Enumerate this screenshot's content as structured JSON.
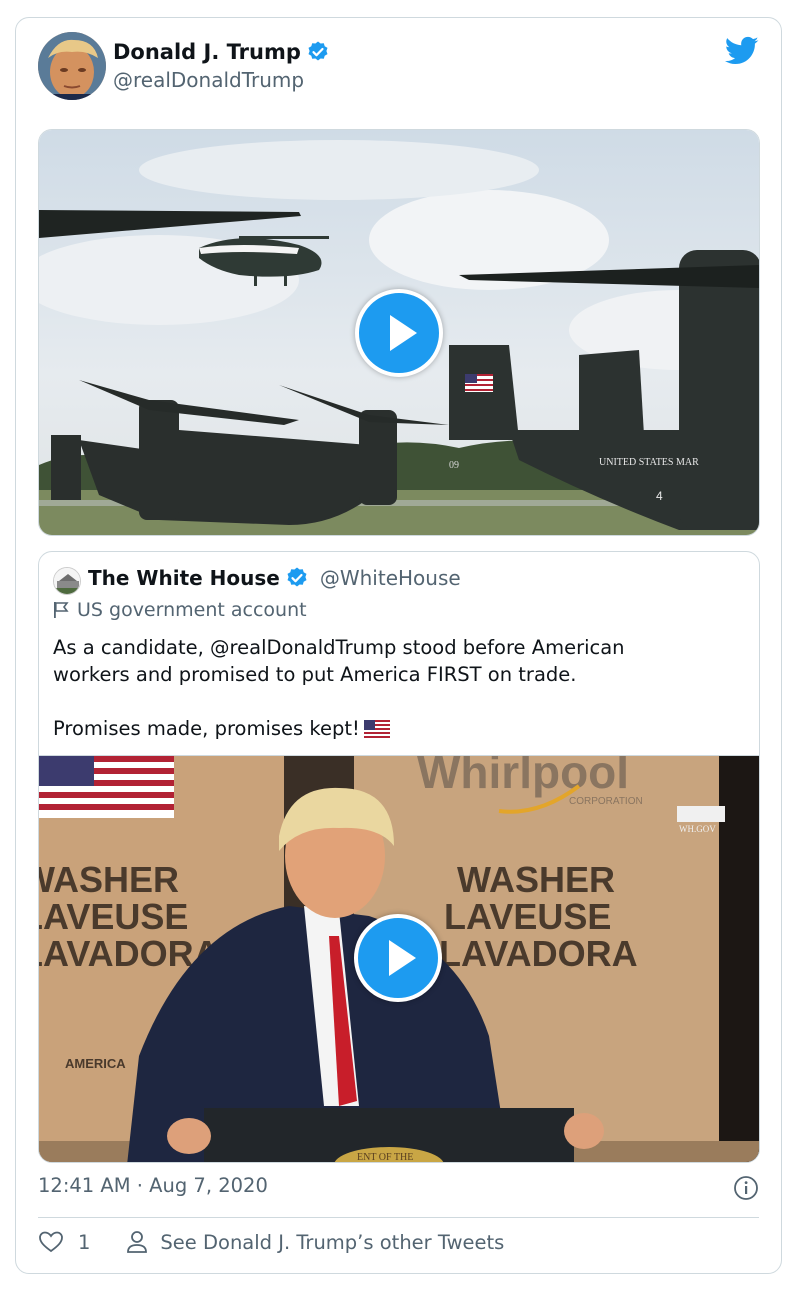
{
  "author": {
    "name": "Donald J. Trump",
    "handle": "@realDonaldTrump",
    "verified": true
  },
  "icons": {
    "verified": "verified-badge-icon",
    "brand": "twitter-bird-icon",
    "play": "play-icon",
    "flag": "flag-icon",
    "info": "info-icon",
    "like": "heart-icon",
    "profile": "person-icon"
  },
  "colors": {
    "accent": "#1d9bf0",
    "text": "#0f1419",
    "muted": "#536471",
    "border": "#cfd9de"
  },
  "quoted_tweet": {
    "name": "The White House",
    "handle": "@WhiteHouse",
    "label": "US government account",
    "text_line1": "As a candidate, @realDonaldTrump stood before American",
    "text_line2": "workers and promised to put America FIRST on trade.",
    "text_line3": "Promises made, promises kept!",
    "video_boxes": {
      "brand": "Whirlpool",
      "brand_sub": "CORPORATION",
      "washer_en": "WASHER",
      "washer_fr": "LAVEUSE",
      "washer_es": "LAVADORA",
      "america": "AMERICA",
      "watermark": "WH.GOV",
      "podium": "ENT OF THE"
    }
  },
  "main_video": {
    "tail_text": "UNITED STATES MAR",
    "tail_number": "09",
    "nose_number": "4"
  },
  "timestamp": "12:41 AM · Aug 7, 2020",
  "actions": {
    "like_count": "1",
    "other_tweets": "See Donald J. Trump’s other Tweets"
  }
}
